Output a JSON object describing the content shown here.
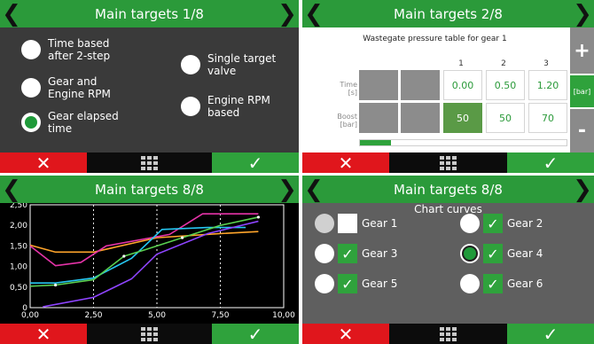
{
  "common": {
    "prev_icon": "chevron-left-icon",
    "next_icon": "chevron-right-icon",
    "cancel": "✕",
    "confirm": "✓"
  },
  "panel1": {
    "title": "Main targets 1/8",
    "options_left": [
      {
        "line1": "Time based",
        "line2": "after 2-step",
        "selected": false
      },
      {
        "line1": "Gear and",
        "line2": "Engine RPM",
        "selected": false
      },
      {
        "line1": "Gear elapsed",
        "line2": "time",
        "selected": true
      }
    ],
    "options_right": [
      {
        "line1": "Single target",
        "line2": "valve",
        "selected": false
      },
      {
        "line1": "Engine RPM",
        "line2": "based",
        "selected": false
      }
    ]
  },
  "panel2": {
    "title": "Main targets 2/8",
    "subtitle": "Wastegate pressure table for gear 1",
    "columns": [
      "1",
      "2",
      "3"
    ],
    "row_time_label": [
      "Time",
      "[s]"
    ],
    "row_boost_label": [
      "Boost",
      "[bar]"
    ],
    "time_values": [
      "0.00",
      "0.50",
      "1.20"
    ],
    "boost_values": [
      "50",
      "50",
      "70"
    ],
    "plus": "+",
    "unit": "[bar]",
    "minus": "-",
    "progress": 0.15
  },
  "panel3": {
    "title": "Main targets 8/8"
  },
  "chart_data": {
    "type": "line",
    "xlim": [
      0,
      10
    ],
    "ylim": [
      0,
      2.5
    ],
    "x_ticks": [
      "0,00",
      "2,50",
      "5,00",
      "7,50",
      "10,00"
    ],
    "y_ticks": [
      "0",
      "0,50",
      "1,00",
      "1,50",
      "2,00",
      "2,50"
    ],
    "grid": "dotted vertical at 2.5/5/7.5",
    "series": [
      {
        "color": "#ffa52b",
        "x": [
          0,
          1,
          2.5,
          5,
          7.5,
          9
        ],
        "y": [
          1.52,
          1.35,
          1.35,
          1.7,
          1.8,
          1.85
        ]
      },
      {
        "color": "#e533a8",
        "x": [
          0,
          1,
          2,
          3,
          5.5,
          6.8,
          9
        ],
        "y": [
          1.5,
          1.02,
          1.1,
          1.5,
          1.78,
          2.28,
          2.28
        ]
      },
      {
        "color": "#26c6f0",
        "x": [
          0,
          1,
          2.5,
          4,
          5.2,
          7,
          8.5
        ],
        "y": [
          0.6,
          0.6,
          0.72,
          1.2,
          1.9,
          1.95,
          1.95
        ]
      },
      {
        "color": "#5ad050",
        "x": [
          0,
          1,
          2.5,
          3.7,
          4.5,
          6,
          7.5,
          9
        ],
        "y": [
          0.52,
          0.55,
          0.68,
          1.25,
          1.4,
          1.7,
          2.0,
          2.2
        ]
      },
      {
        "color": "#8e44ff",
        "x": [
          0.5,
          2.5,
          4,
          5,
          7,
          9
        ],
        "y": [
          0.02,
          0.25,
          0.7,
          1.3,
          1.8,
          2.1
        ]
      }
    ]
  },
  "panel4": {
    "title": "Main targets 8/8",
    "subtitle": "Chart curves",
    "gears": [
      {
        "label": "Gear 1",
        "checked": false,
        "radio": "dim"
      },
      {
        "label": "Gear 2",
        "checked": true,
        "radio": "normal"
      },
      {
        "label": "Gear 3",
        "checked": true,
        "radio": "normal"
      },
      {
        "label": "Gear 4",
        "checked": true,
        "radio": "selected"
      },
      {
        "label": "Gear 5",
        "checked": true,
        "radio": "normal"
      },
      {
        "label": "Gear 6",
        "checked": true,
        "radio": "normal"
      }
    ],
    "ok": "OK"
  }
}
